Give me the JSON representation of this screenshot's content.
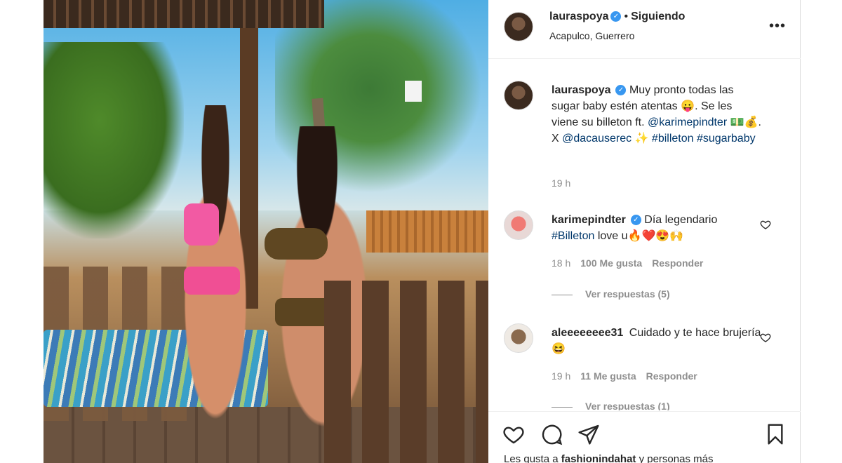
{
  "post": {
    "username": "lauraspoya",
    "following_label": "Siguiendo",
    "location": "Acapulco, Guerrero"
  },
  "caption": {
    "username": "lauraspoya",
    "text1": "Muy pronto todas las sugar baby estén atentas",
    "emoji1": "😛",
    "text2": ". Se les viene su billeton ft.",
    "mention1": "@karimepindter",
    "emoji2": "💵💰",
    "text3": ". X",
    "mention2": "@dacauserec",
    "emoji3": "✨",
    "hashtag1": "#billeton",
    "hashtag2": "#sugarbaby",
    "time": "19 h"
  },
  "comments": [
    {
      "username": "karimepindter",
      "text": "Día legendario",
      "hashtag": "#Billeton",
      "text2": "love u",
      "emoji": "🔥❤️😍🙌",
      "time": "18 h",
      "likes": "100 Me gusta",
      "reply": "Responder",
      "view_replies": "Ver respuestas (5)"
    },
    {
      "username": "aleeeeeeee31",
      "text": "Cuidado y te hace brujería",
      "emoji": "😆",
      "time": "19 h",
      "likes": "11 Me gusta",
      "reply": "Responder",
      "view_replies": "Ver respuestas (1)"
    }
  ],
  "likes_line": {
    "prefix": "Les gusta a",
    "user": "fashionindahat",
    "suffix": "y personas más"
  },
  "icons": {
    "more": "more-options-icon",
    "heart": "heart-icon",
    "comment": "comment-icon",
    "share": "share-icon",
    "save": "bookmark-icon"
  },
  "colors": {
    "verified": "#3897f0",
    "link": "#00376b",
    "muted": "#8e8e8e"
  }
}
